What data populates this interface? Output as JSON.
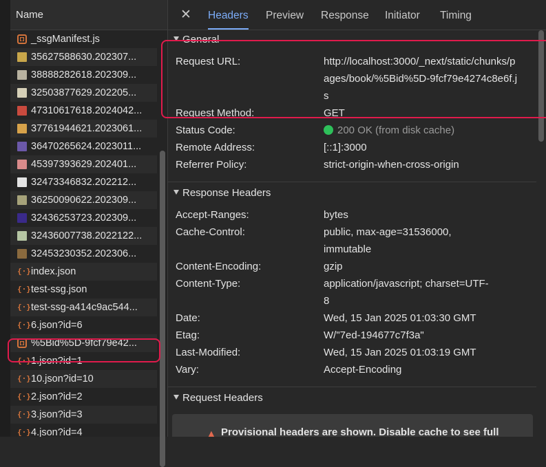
{
  "list": {
    "header": "Name",
    "items": [
      {
        "label": "_ssgManifest.js",
        "icon": "js-file-icon",
        "kind": "js"
      },
      {
        "label": "35627588630.202307...",
        "icon": "image-file-icon",
        "kind": "img",
        "color": "#c8a64a"
      },
      {
        "label": "38888282618.202309...",
        "icon": "image-file-icon",
        "kind": "img",
        "color": "#b8b2a0"
      },
      {
        "label": "32503877629.202205...",
        "icon": "image-file-icon",
        "kind": "img",
        "color": "#d6d0b8"
      },
      {
        "label": "47310617618.2024042...",
        "icon": "image-file-icon",
        "kind": "img",
        "color": "#c94a3e"
      },
      {
        "label": "37761944621.2023061...",
        "icon": "image-file-icon",
        "kind": "img",
        "color": "#d7a24a"
      },
      {
        "label": "36470265624.2023011...",
        "icon": "image-file-icon",
        "kind": "img",
        "color": "#6b58a8"
      },
      {
        "label": "45397393629.202401...",
        "icon": "image-file-icon",
        "kind": "img",
        "color": "#d98a8a"
      },
      {
        "label": "32473346832.202212...",
        "icon": "image-file-icon",
        "kind": "img",
        "color": "#e4e4e4"
      },
      {
        "label": "36250090622.202309...",
        "icon": "image-file-icon",
        "kind": "img",
        "color": "#a6a27a"
      },
      {
        "label": "32436253723.202309...",
        "icon": "image-file-icon",
        "kind": "img",
        "color": "#3a2a8a"
      },
      {
        "label": "32436007738.2022122...",
        "icon": "image-file-icon",
        "kind": "img",
        "color": "#b6c6a4"
      },
      {
        "label": "32453230352.202306...",
        "icon": "image-file-icon",
        "kind": "img",
        "color": "#8a6a3e"
      },
      {
        "label": "index.json",
        "icon": "json-file-icon",
        "kind": "json"
      },
      {
        "label": "test-ssg.json",
        "icon": "json-file-icon",
        "kind": "json"
      },
      {
        "label": "test-ssg-a414c9ac544...",
        "icon": "json-file-icon",
        "kind": "json"
      },
      {
        "label": "6.json?id=6",
        "icon": "json-file-icon",
        "kind": "json"
      },
      {
        "label": "%5Bid%5D-9fcf79e42...",
        "icon": "js-file-icon",
        "kind": "js"
      },
      {
        "label": "1.json?id=1",
        "icon": "json-file-icon",
        "kind": "json"
      },
      {
        "label": "10.json?id=10",
        "icon": "json-file-icon",
        "kind": "json"
      },
      {
        "label": "2.json?id=2",
        "icon": "json-file-icon",
        "kind": "json"
      },
      {
        "label": "3.json?id=3",
        "icon": "json-file-icon",
        "kind": "json"
      },
      {
        "label": "4.json?id=4",
        "icon": "json-file-icon",
        "kind": "json"
      }
    ]
  },
  "tabs": {
    "close_icon": "close-icon",
    "items": [
      "Headers",
      "Preview",
      "Response",
      "Initiator",
      "Timing"
    ],
    "active": "Headers"
  },
  "general": {
    "title": "General",
    "request_url_label": "Request URL:",
    "request_url_lines": [
      "http://localhost:3000/_next/static/chunks/p",
      "ages/book/%5Bid%5D-9fcf79e4274c8e6f.j",
      "s"
    ],
    "request_method_label": "Request Method:",
    "request_method": "GET",
    "status_code_label": "Status Code:",
    "status_code": "200 OK (from disk cache)",
    "status_color": "#2ec05a",
    "remote_address_label": "Remote Address:",
    "remote_address": "[::1]:3000",
    "referrer_policy_label": "Referrer Policy:",
    "referrer_policy": "strict-origin-when-cross-origin"
  },
  "response_headers": {
    "title": "Response Headers",
    "accept_ranges_label": "Accept-Ranges:",
    "accept_ranges": "bytes",
    "cache_control_label": "Cache-Control:",
    "cache_control_lines": [
      "public, max-age=31536000,",
      "immutable"
    ],
    "content_encoding_label": "Content-Encoding:",
    "content_encoding": "gzip",
    "content_type_label": "Content-Type:",
    "content_type_lines": [
      "application/javascript; charset=UTF-",
      "8"
    ],
    "date_label": "Date:",
    "date": "Wed, 15 Jan 2025 01:03:30 GMT",
    "etag_label": "Etag:",
    "etag": "W/\"7ed-194677c7f3a\"",
    "last_modified_label": "Last-Modified:",
    "last_modified": "Wed, 15 Jan 2025 01:03:19 GMT",
    "vary_label": "Vary:",
    "vary": "Accept-Encoding"
  },
  "request_headers": {
    "title": "Request Headers",
    "warning_icon": "warning-icon",
    "warning_text": "Provisional headers are shown. Disable cache to see full"
  },
  "colors": {
    "accent": "#7cacf8",
    "highlight": "#e01b4c",
    "warning": "#e0694f"
  }
}
